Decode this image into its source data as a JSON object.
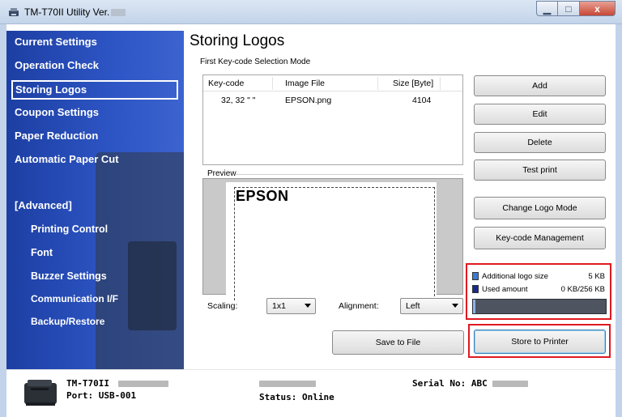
{
  "window": {
    "title": "TM-T70II Utility Ver.",
    "icons": {
      "app": "printer-app-icon",
      "minimize": "minimize-icon",
      "maximize": "maximize-icon",
      "close": "close-icon"
    },
    "glyphs": {
      "minimize": "▁",
      "maximize": "□",
      "close": "x"
    }
  },
  "sidebar": {
    "items": [
      {
        "label": "Current Settings"
      },
      {
        "label": "Operation Check"
      },
      {
        "label": "Storing Logos",
        "selected": true
      },
      {
        "label": "Coupon Settings"
      },
      {
        "label": "Paper Reduction"
      },
      {
        "label": "Automatic Paper Cut"
      },
      {
        "label": "[Advanced]"
      },
      {
        "label": "Printing Control"
      },
      {
        "label": "Font"
      },
      {
        "label": "Buzzer Settings"
      },
      {
        "label": "Communication I/F"
      },
      {
        "label": "Backup/Restore"
      }
    ]
  },
  "main": {
    "title": "Storing Logos",
    "mode": "First Key-code Selection Mode",
    "table": {
      "columns": [
        "Key-code",
        "Image File",
        "Size [Byte]"
      ],
      "rows": [
        {
          "key_code": "32, 32  \" \"",
          "image_file": "EPSON.png",
          "size": "4104"
        }
      ]
    },
    "preview": {
      "label": "Preview",
      "logo_text": "EPSON"
    },
    "scaling": {
      "label": "Scaling:",
      "value": "1x1"
    },
    "alignment": {
      "label": "Alignment:",
      "value": "Left"
    },
    "buttons": {
      "add": "Add",
      "edit": "Edit",
      "delete": "Delete",
      "test_print": "Test print",
      "change_logo_mode": "Change Logo Mode",
      "key_code_management": "Key-code Management",
      "save_to_file": "Save to File",
      "store_to_printer": "Store to Printer"
    },
    "memory": {
      "additional_label": "Additional logo size",
      "additional_value": "5 KB",
      "used_label": "Used amount",
      "used_value": "0 KB/256 KB",
      "used_fraction": 0.02,
      "additional_color": "#3a7bd5",
      "used_color": "#1a2a8a"
    }
  },
  "status": {
    "model": "TM-T70II",
    "port": "Port: USB-001",
    "status": "Status: Online",
    "serial": "Serial No: ABC"
  },
  "colors": {
    "sidebar": "#2d55c4",
    "highlight": "#e0191f"
  }
}
